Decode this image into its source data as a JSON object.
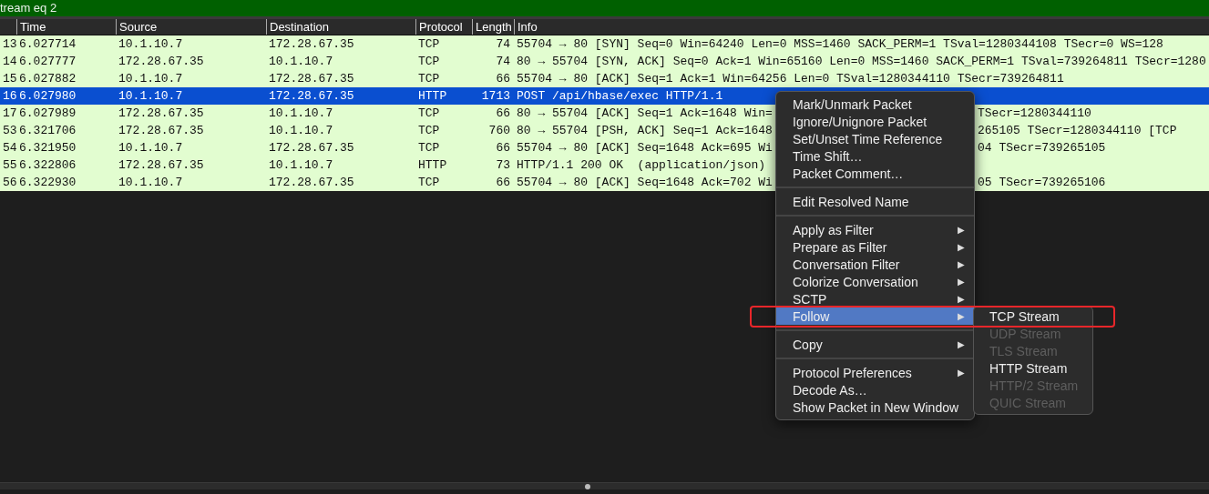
{
  "filter_bar": {
    "text": "tream eq 2"
  },
  "columns": [
    {
      "kind": "no"
    },
    {
      "label": "Time",
      "kind": "text"
    },
    {
      "label": "Source",
      "kind": "text"
    },
    {
      "label": "Destination",
      "kind": "text"
    },
    {
      "label": "Protocol",
      "kind": "text"
    },
    {
      "label": "Length",
      "kind": "num"
    },
    {
      "label": "Info",
      "kind": "info"
    }
  ],
  "rows": [
    {
      "no": "13",
      "time": "6.027714",
      "source": "10.1.10.7",
      "destination": "172.28.67.35",
      "protocol": "TCP",
      "length": "74",
      "info": "55704 → 80 [SYN] Seq=0 Win=64240 Len=0 MSS=1460 SACK_PERM=1 TSval=1280344108 TSecr=0 WS=128",
      "selected": false
    },
    {
      "no": "14",
      "time": "6.027777",
      "source": "172.28.67.35",
      "destination": "10.1.10.7",
      "protocol": "TCP",
      "length": "74",
      "info": "80 → 55704 [SYN, ACK] Seq=0 Ack=1 Win=65160 Len=0 MSS=1460 SACK_PERM=1 TSval=739264811 TSecr=1280",
      "selected": false
    },
    {
      "no": "15",
      "time": "6.027882",
      "source": "10.1.10.7",
      "destination": "172.28.67.35",
      "protocol": "TCP",
      "length": "66",
      "info": "55704 → 80 [ACK] Seq=1 Ack=1 Win=64256 Len=0 TSval=1280344110 TSecr=739264811",
      "selected": false
    },
    {
      "no": "16",
      "time": "6.027980",
      "source": "10.1.10.7",
      "destination": "172.28.67.35",
      "protocol": "HTTP",
      "length": "1713",
      "info": "POST /api/hbase/exec HTTP/1.1",
      "selected": true
    },
    {
      "no": "17",
      "time": "6.027989",
      "source": "172.28.67.35",
      "destination": "10.1.10.7",
      "protocol": "TCP",
      "length": "66",
      "info": "80 → 55704 [ACK] Seq=1 Ack=1648 Win=",
      "info_tail": "TSecr=1280344110",
      "selected": false
    },
    {
      "no": "53",
      "time": "6.321706",
      "source": "172.28.67.35",
      "destination": "10.1.10.7",
      "protocol": "TCP",
      "length": "760",
      "info": "80 → 55704 [PSH, ACK] Seq=1 Ack=1648",
      "info_tail": "265105 TSecr=1280344110 [TCP",
      "selected": false
    },
    {
      "no": "54",
      "time": "6.321950",
      "source": "10.1.10.7",
      "destination": "172.28.67.35",
      "protocol": "TCP",
      "length": "66",
      "info": "55704 → 80 [ACK] Seq=1648 Ack=695 Wi",
      "info_tail": "04 TSecr=739265105",
      "selected": false
    },
    {
      "no": "55",
      "time": "6.322806",
      "source": "172.28.67.35",
      "destination": "10.1.10.7",
      "protocol": "HTTP",
      "length": "73",
      "info": "HTTP/1.1 200 OK  (application/json)",
      "selected": false
    },
    {
      "no": "56",
      "time": "6.322930",
      "source": "10.1.10.7",
      "destination": "172.28.67.35",
      "protocol": "TCP",
      "length": "66",
      "info": "55704 → 80 [ACK] Seq=1648 Ack=702 Wi",
      "info_tail": "05 TSecr=739265106",
      "selected": false
    }
  ],
  "context_menu": {
    "groups": [
      [
        {
          "label": "Mark/Unmark Packet",
          "submenu": false,
          "selected": false
        },
        {
          "label": "Ignore/Unignore Packet",
          "submenu": false,
          "selected": false
        },
        {
          "label": "Set/Unset Time Reference",
          "submenu": false,
          "selected": false
        },
        {
          "label": "Time Shift…",
          "submenu": false,
          "selected": false
        },
        {
          "label": "Packet Comment…",
          "submenu": false,
          "selected": false
        }
      ],
      [
        {
          "label": "Edit Resolved Name",
          "submenu": false,
          "selected": false
        }
      ],
      [
        {
          "label": "Apply as Filter",
          "submenu": true,
          "selected": false
        },
        {
          "label": "Prepare as Filter",
          "submenu": true,
          "selected": false
        },
        {
          "label": "Conversation Filter",
          "submenu": true,
          "selected": false
        },
        {
          "label": "Colorize Conversation",
          "submenu": true,
          "selected": false
        },
        {
          "label": "SCTP",
          "submenu": true,
          "selected": false
        },
        {
          "label": "Follow",
          "submenu": true,
          "selected": true
        }
      ],
      [
        {
          "label": "Copy",
          "submenu": true,
          "selected": false
        }
      ],
      [
        {
          "label": "Protocol Preferences",
          "submenu": true,
          "selected": false
        },
        {
          "label": "Decode As…",
          "submenu": false,
          "selected": false
        },
        {
          "label": "Show Packet in New Window",
          "submenu": false,
          "selected": false
        }
      ]
    ],
    "arrow": "▶"
  },
  "submenu": [
    {
      "label": "TCP Stream",
      "disabled": false
    },
    {
      "label": "UDP Stream",
      "disabled": true
    },
    {
      "label": "TLS Stream",
      "disabled": true
    },
    {
      "label": "HTTP Stream",
      "disabled": false
    },
    {
      "label": "HTTP/2 Stream",
      "disabled": true
    },
    {
      "label": "QUIC Stream",
      "disabled": true
    }
  ]
}
